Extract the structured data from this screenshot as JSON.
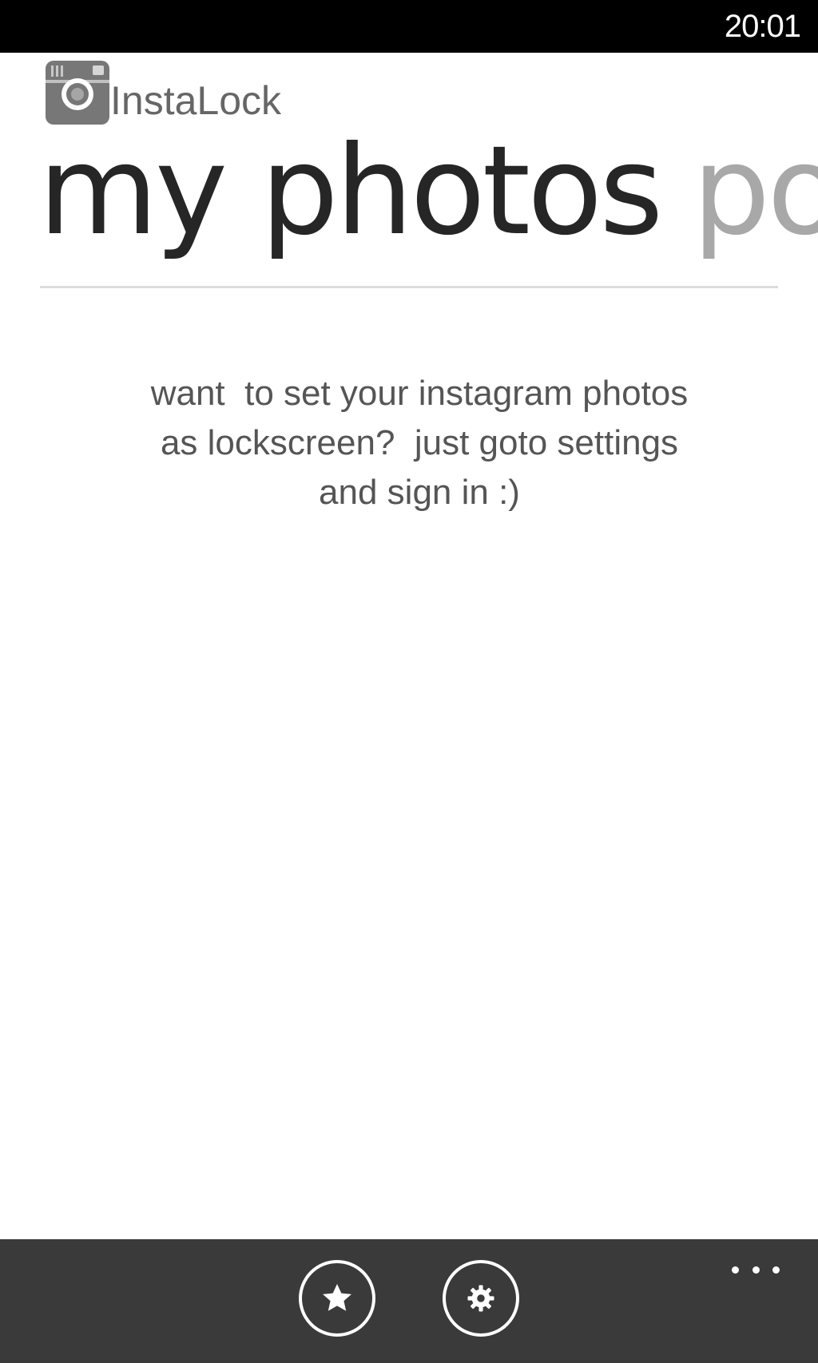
{
  "status_bar": {
    "time": "20:01"
  },
  "app": {
    "name": "InstaLock",
    "logo_icon": "camera-icon",
    "logo_color": "#777777"
  },
  "pivot": {
    "items": [
      {
        "label": "my photos",
        "active": true
      },
      {
        "label": "popular",
        "active": false
      }
    ]
  },
  "main": {
    "message_lines": [
      "want  to set your instagram photos",
      "as lockscreen?  just goto settings",
      "and sign in :)"
    ]
  },
  "app_bar": {
    "buttons": [
      {
        "icon": "star-icon",
        "name": "favorite-button"
      },
      {
        "icon": "gear-icon",
        "name": "settings-button"
      }
    ],
    "more_icon": "more-options-icon"
  },
  "colors": {
    "status_bar_bg": "#000000",
    "app_bar_bg": "#3a3a3a",
    "title_active": "#262626",
    "title_inactive": "#a8a8a8",
    "text": "#555555"
  }
}
